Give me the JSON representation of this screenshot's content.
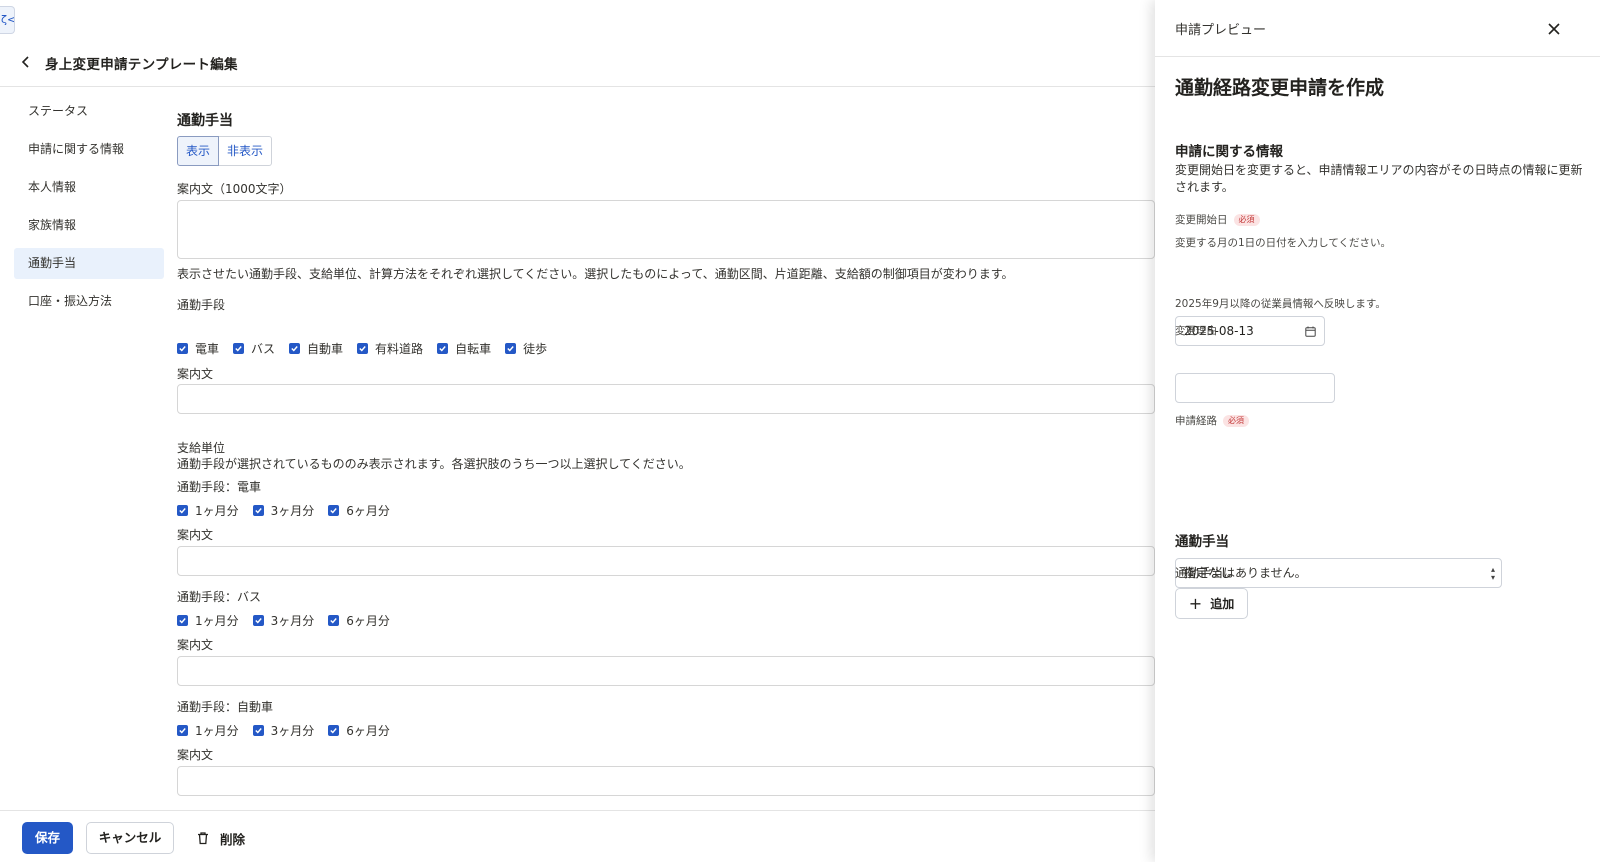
{
  "edge_tab": {
    "label": "ζ<"
  },
  "header": {
    "title": "身上変更申請テンプレート編集"
  },
  "nav": {
    "items": [
      {
        "label": "ステータス"
      },
      {
        "label": "申請に関する情報"
      },
      {
        "label": "本人情報"
      },
      {
        "label": "家族情報"
      },
      {
        "label": "通勤手当"
      },
      {
        "label": "口座・振込方法"
      }
    ],
    "active_index": 4
  },
  "main": {
    "section_title": "通勤手当",
    "toggle": {
      "show": "表示",
      "hide": "非表示",
      "selected": "表示"
    },
    "guide_label": "案内文（1000文字）",
    "guide_desc": "表示させたい通勤手段、支給単位、計算方法をそれぞれ選択してください。選択したものによって、通勤区間、片道距離、支給額の制御項目が変わります。",
    "means_label": "通勤手段",
    "means_options": [
      "電車",
      "バス",
      "自動車",
      "有料道路",
      "自転車",
      "徒歩"
    ],
    "guide_short": "案内文",
    "unit_label": "支給単位",
    "unit_desc": "通勤手段が選択されているもののみ表示されます。各選択肢のうち一つ以上選択してください。",
    "unit_groups": [
      {
        "title": "通勤手段：電車",
        "options": [
          "1ヶ月分",
          "3ヶ月分",
          "6ヶ月分"
        ]
      },
      {
        "title": "通勤手段：バス",
        "options": [
          "1ヶ月分",
          "3ヶ月分",
          "6ヶ月分"
        ]
      },
      {
        "title": "通勤手段：自動車",
        "options": [
          "1ヶ月分",
          "3ヶ月分",
          "6ヶ月分"
        ]
      }
    ]
  },
  "footer": {
    "save": "保存",
    "cancel": "キャンセル",
    "delete": "削除"
  },
  "drawer": {
    "title": "申請プレビュー",
    "heading": "通勤経路変更申請を作成",
    "info_title": "申請に関する情報",
    "info_desc_1": "変更開始日を変更すると、申請情報エリアの内容がその日時点の情報に更新",
    "info_desc_2": "されます。",
    "start_label": "変更開始日",
    "required": "必須",
    "start_hint": "変更する月の1日の日付を入力してください。",
    "start_value": "2025-08-13",
    "start_note": "2025年9月以降の従業員情報へ反映します。",
    "reason_label": "変更理由",
    "route_label": "申請経路",
    "route_value": "指定なし",
    "allowance_title": "通勤手当",
    "allowance_empty": "通勤手当はありません。",
    "add_label": "追加"
  }
}
